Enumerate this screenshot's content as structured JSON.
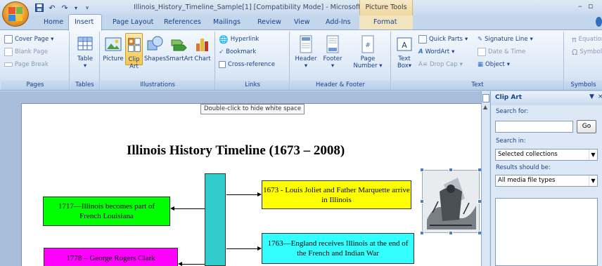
{
  "window": {
    "title": "Illinois_History_Timeline_Sample[1] [Compatibility Mode] - Microsoft Word",
    "context_tab": "Picture Tools",
    "min": "–",
    "max": "▫",
    "close": "×"
  },
  "tabs": [
    "Home",
    "Insert",
    "Page Layout",
    "References",
    "Mailings",
    "Review",
    "View",
    "Add-Ins",
    "Format"
  ],
  "active_tab": "Insert",
  "ribbon": {
    "pages": {
      "label": "Pages",
      "cover_page": "Cover Page",
      "blank_page": "Blank Page",
      "page_break": "Page Break"
    },
    "tables": {
      "label": "Tables",
      "table": "Table"
    },
    "illustrations": {
      "label": "Illustrations",
      "picture": "Picture",
      "clip_art_1": "Clip",
      "clip_art_2": "Art",
      "shapes": "Shapes",
      "smartart": "SmartArt",
      "chart": "Chart"
    },
    "links": {
      "label": "Links",
      "hyperlink": "Hyperlink",
      "bookmark": "Bookmark",
      "cross_reference": "Cross-reference"
    },
    "header_footer": {
      "label": "Header & Footer",
      "header": "Header",
      "footer": "Footer",
      "page_number_1": "Page",
      "page_number_2": "Number"
    },
    "text": {
      "label": "Text",
      "text_box_1": "Text",
      "text_box_2": "Box",
      "quick_parts": "Quick Parts",
      "signature_line": "Signature Line",
      "wordart": "WordArt",
      "date_time": "Date & Time",
      "drop_cap": "Drop Cap",
      "object": "Object"
    },
    "symbols": {
      "label": "Symbols",
      "equation": "Equation",
      "symbol": "Symbol"
    }
  },
  "document": {
    "tooltip": "Double-click to hide white space",
    "title": "Illinois History Timeline (1673 – 2008)",
    "events": {
      "e1673": "1673 - Louis Joliet and Father Marquette arrive in Illinois",
      "e1717": "1717—Illinois becomes part of French Louisiana",
      "e1763": "1763—England receives Illinois at the end of the French and Indian War",
      "e1778": "1778 – George Rogers Clark"
    },
    "colors": {
      "e1673": "#ffff00",
      "e1717": "#00ff00",
      "e1763": "#33ffff",
      "e1778": "#ff00ff",
      "trunk": "#33cccc"
    }
  },
  "clip_art_pane": {
    "title": "Clip Art",
    "search_for_label": "Search for:",
    "search_value": "",
    "go": "Go",
    "search_in_label": "Search in:",
    "search_in_value": "Selected collections",
    "results_label": "Results should be:",
    "results_value": "All media file types"
  }
}
